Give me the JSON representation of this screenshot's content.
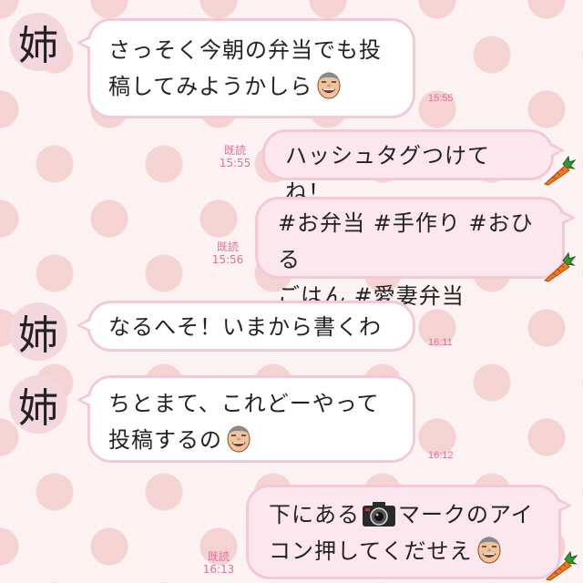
{
  "avatar_char": "姉",
  "messages": [
    {
      "id": "m1",
      "side": "left",
      "line1": "さっそく今朝の弁当でも投",
      "line2": "稿してみようかしら",
      "time": "15:55"
    },
    {
      "id": "m2",
      "side": "right",
      "line1": "ハッシュタグつけてね！",
      "read": "既読",
      "time": "15:55"
    },
    {
      "id": "m3",
      "side": "right",
      "line1": "#お弁当 #手作り #おひる",
      "line2": "ごはん #愛妻弁当",
      "read": "既読",
      "time": "15:56"
    },
    {
      "id": "m4",
      "side": "left",
      "line1": "なるへそ！いまから書くわ",
      "time": "16:11"
    },
    {
      "id": "m5",
      "side": "left",
      "line1": "ちとまて、これどーやって",
      "line2": "投稿するの",
      "time": "16:12"
    },
    {
      "id": "m6",
      "side": "right",
      "line1a": "下にある",
      "line1b": "マークのアイ",
      "line2": "コン押してくだせえ",
      "read": "既読",
      "time": "16:13"
    }
  ],
  "icons": {
    "face": "smiling-old-man-emoji",
    "carrot": "carrot-sticker",
    "camera": "camera-icon"
  },
  "colors": {
    "bubble_border": "#f3c9d8",
    "bubble_right_fill": "#fde7ee",
    "timestamp": "#e0709a",
    "background_dots": "#f6d3d3"
  }
}
